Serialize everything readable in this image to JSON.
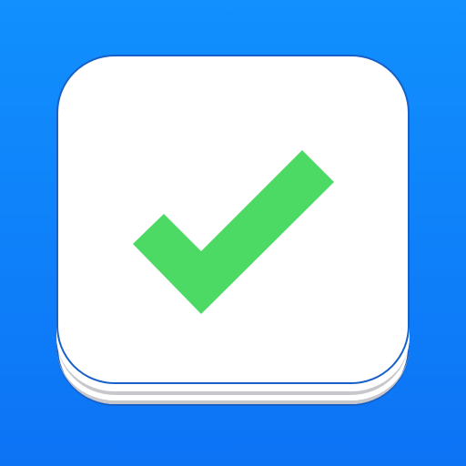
{
  "icon": {
    "background_top": "#1190FE",
    "background_bottom": "#0C73F5",
    "card_color": "#FFFFFF",
    "card_outline": "#1660C8",
    "stack_line_color": "#C7C7CC",
    "check_color": "#4CD964",
    "glyph": "checkmark-icon"
  }
}
